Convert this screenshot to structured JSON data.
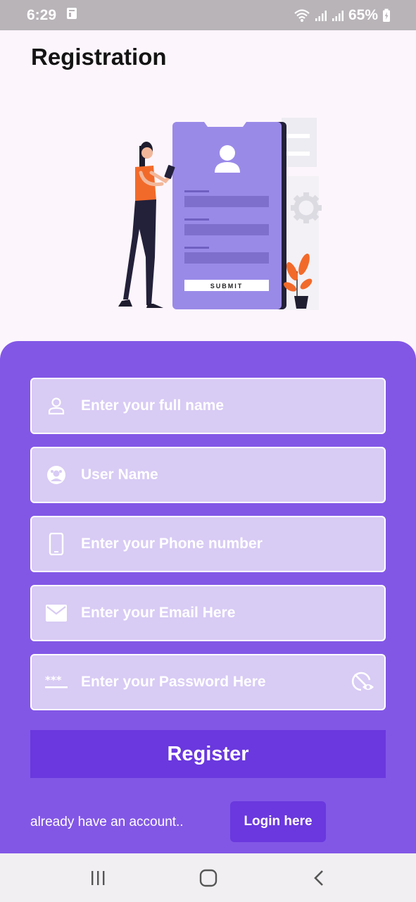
{
  "status_bar": {
    "time": "6:29",
    "battery": "65%"
  },
  "header": {
    "title": "Registration"
  },
  "illustration": {
    "submit_label": "SUBMIT"
  },
  "form": {
    "fields": [
      {
        "placeholder": "Enter your full name",
        "value": ""
      },
      {
        "placeholder": "User Name",
        "value": ""
      },
      {
        "placeholder": "Enter your Phone number",
        "value": ""
      },
      {
        "placeholder": "Enter your Email Here",
        "value": ""
      },
      {
        "placeholder": "Enter your Password Here",
        "value": ""
      }
    ],
    "register_label": "Register",
    "already_text": "already have an account..",
    "login_label": "Login here"
  },
  "colors": {
    "panel": "#8257e6",
    "button": "#6a38de",
    "field": "#d8cbf4",
    "accent_orange": "#f26a2a"
  }
}
